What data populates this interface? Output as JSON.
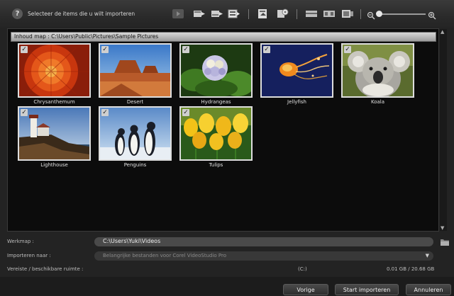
{
  "header": {
    "instruction": "Selecteer de items die u wilt importeren"
  },
  "toolbar": {
    "icons": [
      "play-icon",
      "import-to-track-icon",
      "import-to-track-2-icon",
      "import-to-track-3-icon",
      "import-to-library-icon",
      "settings-icon",
      "split-icon",
      "filmstrip-icon",
      "scene-icon",
      "zoom-out-icon",
      "zoom-in-icon"
    ]
  },
  "folder": {
    "label": "Inhoud map : C:\\Users\\Public\\Pictures\\Sample Pictures"
  },
  "items": [
    {
      "caption": "Chrysanthemum",
      "checked": true
    },
    {
      "caption": "Desert",
      "checked": true
    },
    {
      "caption": "Hydrangeas",
      "checked": true
    },
    {
      "caption": "Jellyfish",
      "checked": true
    },
    {
      "caption": "Koala",
      "checked": true
    },
    {
      "caption": "Lighthouse",
      "checked": true
    },
    {
      "caption": "Penguins",
      "checked": true
    },
    {
      "caption": "Tulips",
      "checked": true
    }
  ],
  "check_mark": "✓",
  "form": {
    "workfolder_label": "Werkmap :",
    "workfolder_value": "C:\\Users\\Yuki\\Videos",
    "import_to_label": "Importeren naar :",
    "import_to_value": "Belangrijke bestanden voor Corel VideoStudio Pro",
    "space_label": "Vereiste / beschikbare ruimte :",
    "drive": "(C:)",
    "space_value": "0.01 GB / 20.68 GB"
  },
  "buttons": {
    "previous": "Vorige",
    "start_import": "Start importeren",
    "cancel": "Annuleren"
  }
}
